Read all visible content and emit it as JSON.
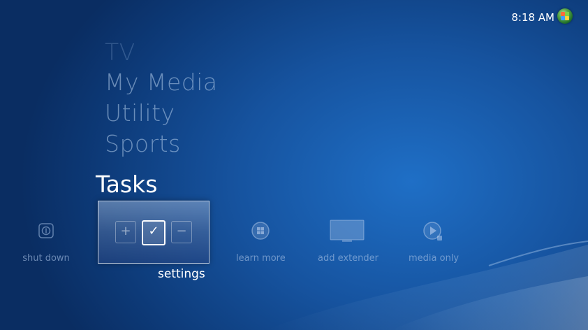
{
  "clock": {
    "time": "8:18 AM"
  },
  "menu": {
    "items": [
      {
        "label": "TV"
      },
      {
        "label": "My Media"
      },
      {
        "label": "Utility"
      },
      {
        "label": "Sports"
      }
    ],
    "active_section": "Tasks"
  },
  "tasks": [
    {
      "label": "shut down",
      "icon": "power-icon"
    },
    {
      "label": "settings",
      "icon": "settings-check-icon",
      "selected": true
    },
    {
      "label": "learn more",
      "icon": "windows-logo-icon"
    },
    {
      "label": "add extender",
      "icon": "monitor-icon"
    },
    {
      "label": "media only",
      "icon": "media-only-icon"
    }
  ],
  "settings_glyphs": {
    "plus": "+",
    "check": "✓",
    "minus": "−"
  },
  "colors": {
    "accent": "#1f6fc6",
    "background": "#0a2d62"
  }
}
